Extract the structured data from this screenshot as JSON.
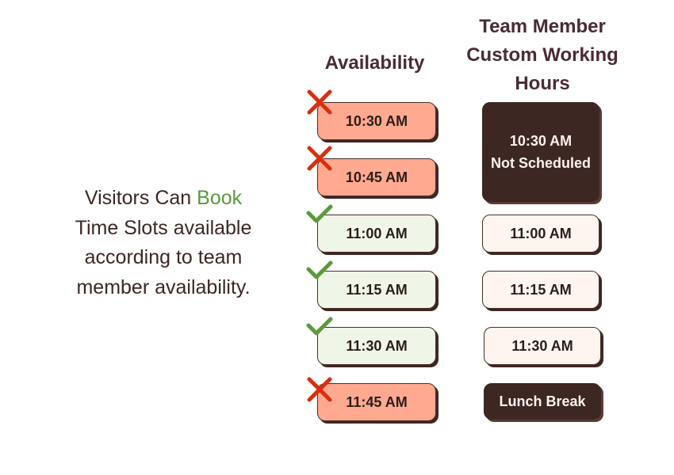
{
  "caption": {
    "line1_prefix": "Visitors Can ",
    "line1_accent": "Book",
    "line2": "Time Slots available",
    "line3": "according to team",
    "line4": "member availability."
  },
  "headings": {
    "availability": "Availability",
    "team_line1": "Team Member",
    "team_line2": "Custom Working",
    "team_line3": "Hours"
  },
  "availability_slots": [
    {
      "time": "10:30 AM",
      "status": "unavailable",
      "icon": "cross-icon"
    },
    {
      "time": "10:45 AM",
      "status": "unavailable",
      "icon": "cross-icon"
    },
    {
      "time": "11:00 AM",
      "status": "available",
      "icon": "check-icon"
    },
    {
      "time": "11:15 AM",
      "status": "available",
      "icon": "check-icon"
    },
    {
      "time": "11:30 AM",
      "status": "available",
      "icon": "check-icon"
    },
    {
      "time": "11:45 AM",
      "status": "unavailable",
      "icon": "cross-icon"
    }
  ],
  "team_hours": {
    "not_scheduled_time": "10:30 AM",
    "not_scheduled_label": "Not Scheduled",
    "slots": [
      "11:00 AM",
      "11:15 AM",
      "11:30 AM"
    ],
    "lunch_label": "Lunch Break"
  },
  "colors": {
    "blocked": "#ffa990",
    "open": "#eff6e8",
    "cross": "#d92e10",
    "check": "#5a9a3c",
    "dark": "#3d2723",
    "accent": "#5a9a3c"
  }
}
